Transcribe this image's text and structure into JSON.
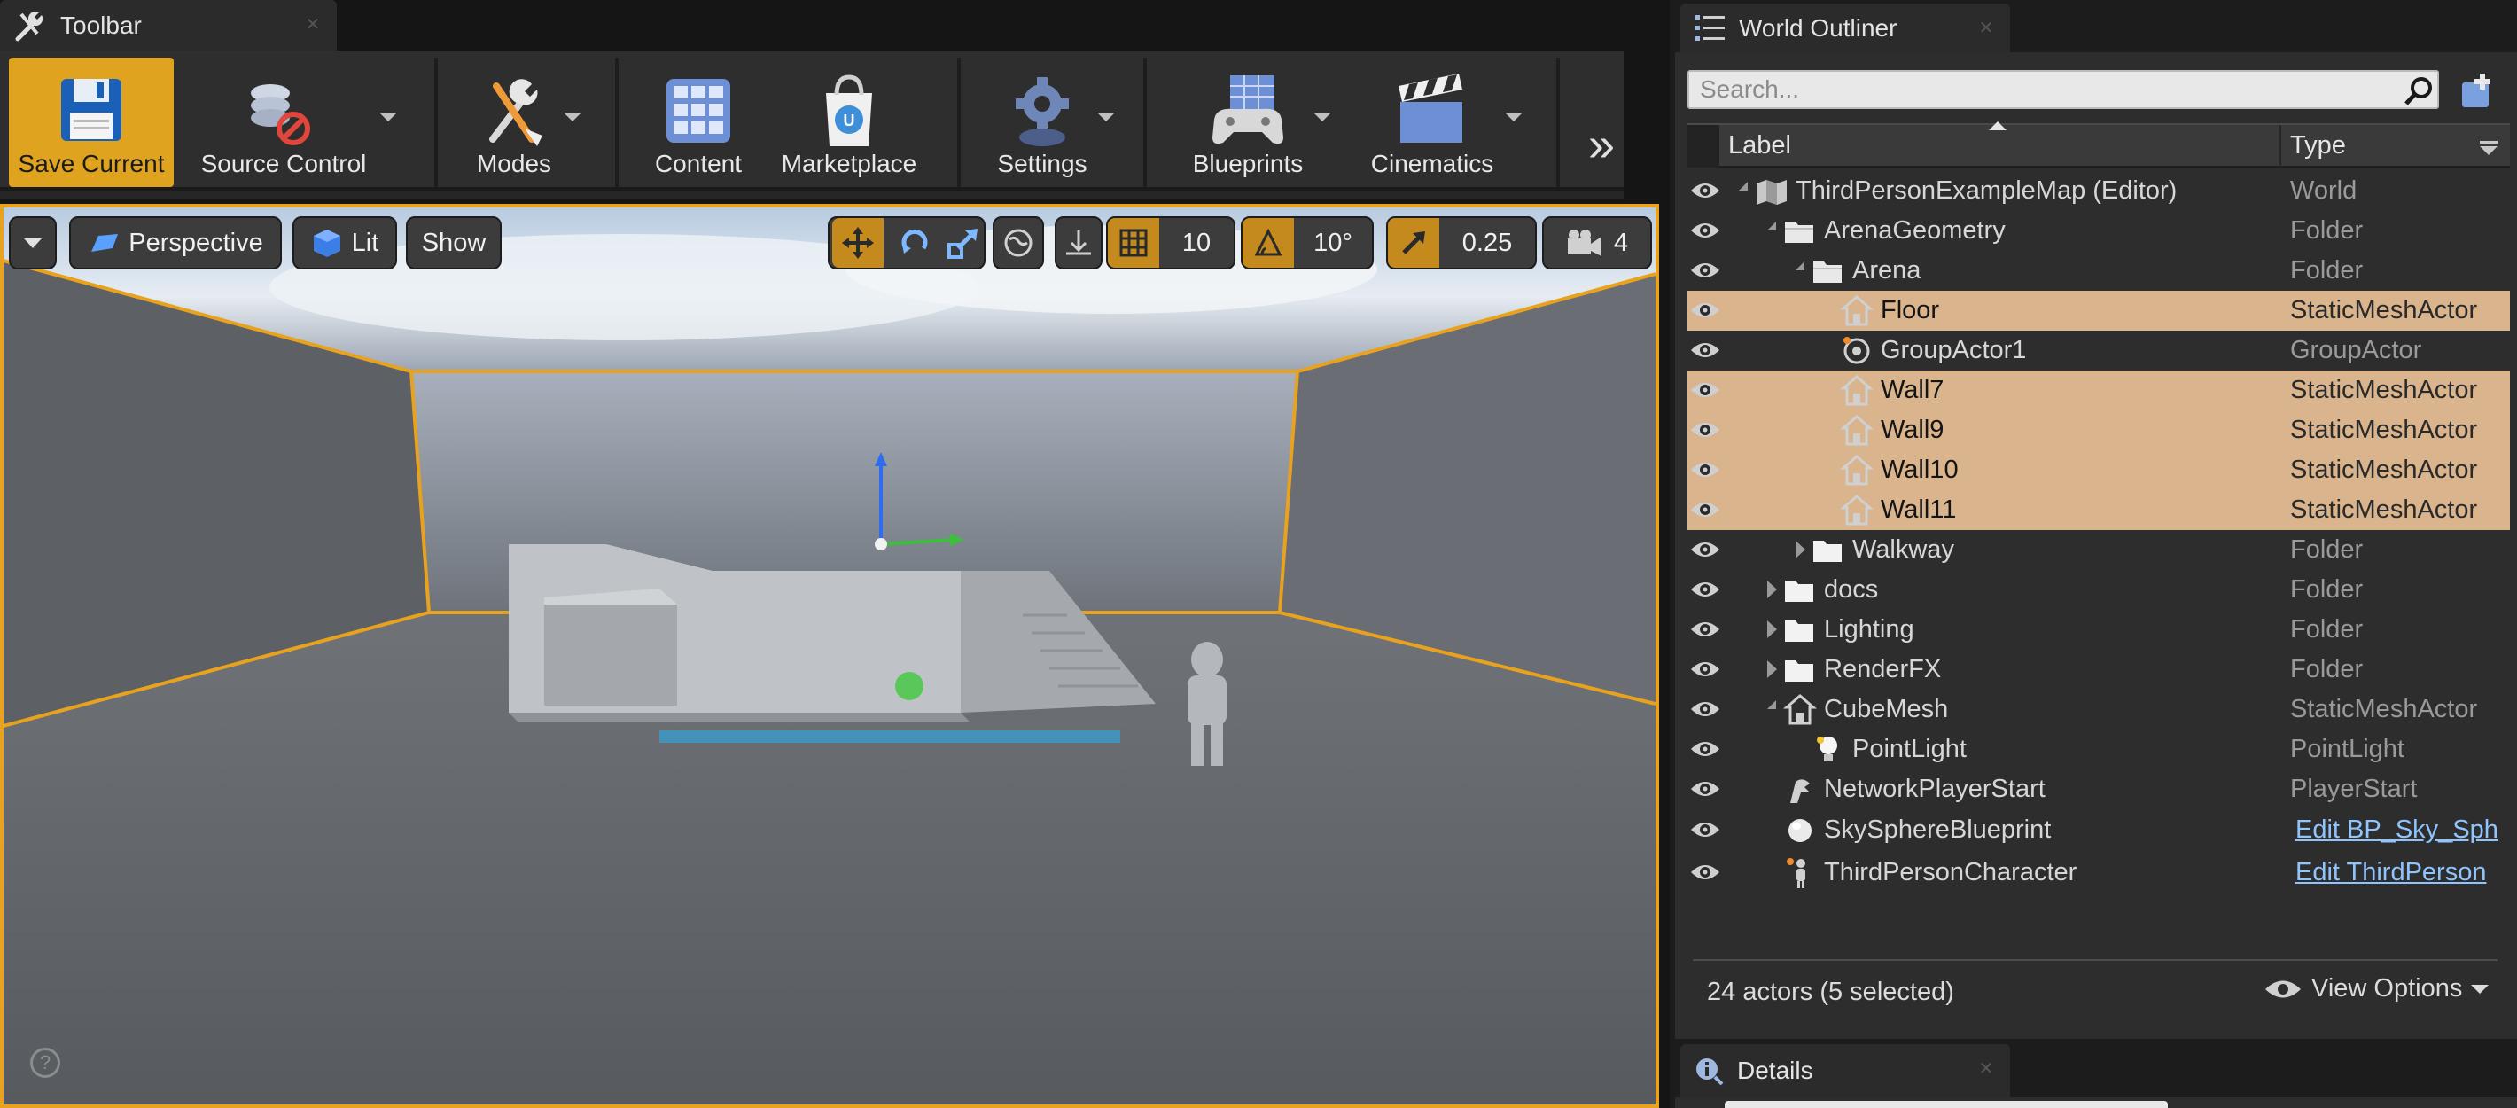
{
  "toolbar": {
    "tab_title": "Toolbar",
    "buttons": [
      {
        "label": "Save Current",
        "icon": "floppy-disk-icon"
      },
      {
        "label": "Source Control",
        "icon": "source-control-disabled-icon"
      },
      {
        "label": "Modes",
        "icon": "modes-tools-icon"
      },
      {
        "label": "Content",
        "icon": "content-grid-icon"
      },
      {
        "label": "Marketplace",
        "icon": "marketplace-bag-icon"
      },
      {
        "label": "Settings",
        "icon": "settings-gear-icon"
      },
      {
        "label": "Blueprints",
        "icon": "blueprints-gamepad-icon"
      },
      {
        "label": "Cinematics",
        "icon": "clapperboard-icon"
      }
    ],
    "more_glyph": "»"
  },
  "viewport": {
    "view_mode": "Perspective",
    "lighting": "Lit",
    "show_label": "Show",
    "grid_snap": "10",
    "rotation_snap": "10°",
    "scale_snap": "0.25",
    "camera_speed": "4"
  },
  "outliner": {
    "tab_title": "World Outliner",
    "search_placeholder": "Search...",
    "columns": {
      "label": "Label",
      "type": "Type"
    },
    "rows": [
      {
        "label": "ThirdPersonExampleMap (Editor)",
        "type": "World",
        "depth": 0,
        "expander": "open",
        "icon": "world-map-icon",
        "selected": false
      },
      {
        "label": "ArenaGeometry",
        "type": "Folder",
        "depth": 1,
        "expander": "open",
        "icon": "folder-open-icon",
        "selected": false
      },
      {
        "label": "Arena",
        "type": "Folder",
        "depth": 2,
        "expander": "open",
        "icon": "folder-open-icon",
        "selected": false
      },
      {
        "label": "Floor",
        "type": "StaticMeshActor",
        "depth": 3,
        "expander": "none",
        "icon": "static-mesh-icon",
        "selected": true
      },
      {
        "label": "GroupActor1",
        "type": "GroupActor",
        "depth": 3,
        "expander": "none",
        "icon": "group-actor-icon",
        "selected": false
      },
      {
        "label": "Wall7",
        "type": "StaticMeshActor",
        "depth": 3,
        "expander": "none",
        "icon": "static-mesh-icon",
        "selected": true
      },
      {
        "label": "Wall9",
        "type": "StaticMeshActor",
        "depth": 3,
        "expander": "none",
        "icon": "static-mesh-icon",
        "selected": true
      },
      {
        "label": "Wall10",
        "type": "StaticMeshActor",
        "depth": 3,
        "expander": "none",
        "icon": "static-mesh-icon",
        "selected": true
      },
      {
        "label": "Wall11",
        "type": "StaticMeshActor",
        "depth": 3,
        "expander": "none",
        "icon": "static-mesh-icon",
        "selected": true
      },
      {
        "label": "Walkway",
        "type": "Folder",
        "depth": 2,
        "expander": "closed",
        "icon": "folder-closed-icon",
        "selected": false
      },
      {
        "label": "docs",
        "type": "Folder",
        "depth": 1,
        "expander": "closed",
        "icon": "folder-closed-icon",
        "selected": false
      },
      {
        "label": "Lighting",
        "type": "Folder",
        "depth": 1,
        "expander": "closed",
        "icon": "folder-closed-icon",
        "selected": false
      },
      {
        "label": "RenderFX",
        "type": "Folder",
        "depth": 1,
        "expander": "closed",
        "icon": "folder-closed-icon",
        "selected": false
      },
      {
        "label": "CubeMesh",
        "type": "StaticMeshActor",
        "depth": 1,
        "expander": "open",
        "icon": "static-mesh-icon",
        "selected": false
      },
      {
        "label": "PointLight",
        "type": "PointLight",
        "depth": 2,
        "expander": "none",
        "icon": "point-light-icon",
        "selected": false
      },
      {
        "label": "NetworkPlayerStart",
        "type": "PlayerStart",
        "depth": 1,
        "expander": "none",
        "icon": "player-start-icon",
        "selected": false
      },
      {
        "label": "SkySphereBlueprint",
        "type": "Edit BP_Sky_Sph",
        "depth": 1,
        "expander": "none",
        "icon": "sphere-icon",
        "selected": false,
        "type_is_link": true
      },
      {
        "label": "ThirdPersonCharacter",
        "type": "Edit ThirdPerson",
        "depth": 1,
        "expander": "none",
        "icon": "character-icon",
        "selected": false,
        "type_is_link": true
      }
    ],
    "actor_count": "24 actors (5 selected)",
    "view_options": "View Options"
  },
  "details": {
    "tab_title": "Details"
  },
  "colors": {
    "accent": "#e0a31f",
    "selection": "#d9b48c",
    "link": "#8fc4ff"
  }
}
